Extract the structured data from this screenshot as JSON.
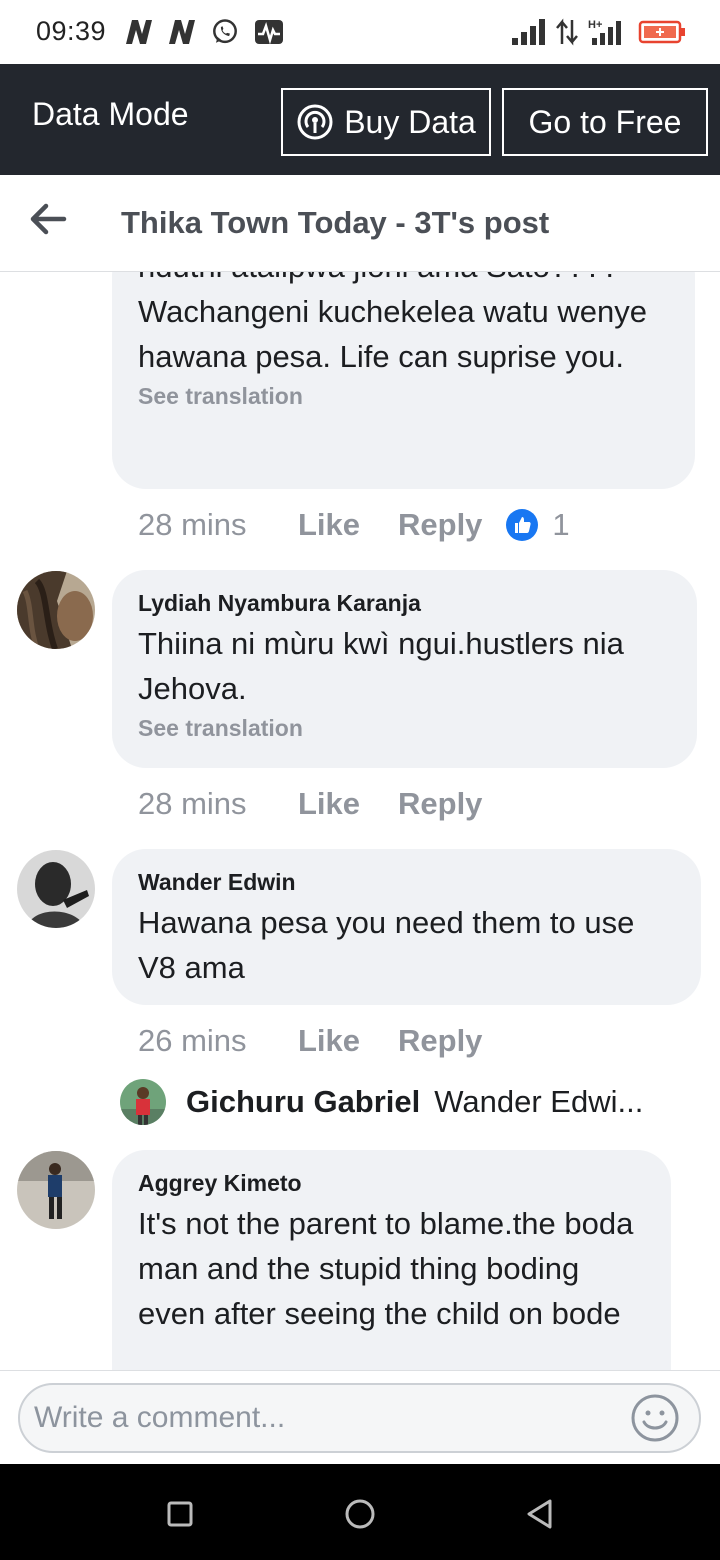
{
  "status_bar": {
    "time": "09:39",
    "icons": [
      "netflix-n-icon",
      "netflix-n-icon",
      "whatsapp-icon",
      "activity-icon",
      "signal-icon",
      "data-arrows-icon",
      "hplus-signal-icon",
      "battery-low-icon"
    ],
    "hplus_label": "H+"
  },
  "data_mode_bar": {
    "label": "Data Mode",
    "buy_data_label": "Buy Data",
    "go_free_label": "Go to Free"
  },
  "header": {
    "title": "Thika Town Today - 3T's post"
  },
  "comments": [
    {
      "lines_partial_top": "ndutni atalipwa jioni ama Sato????",
      "text": "Wachangeni kuchekelea watu wenye hawana pesa. Life can suprise you.",
      "see_translation": "See translation",
      "time": "28 mins",
      "like": "Like",
      "reply": "Reply",
      "reaction_count": "1"
    },
    {
      "author": "Lydiah Nyambura Karanja",
      "text": "Thiina ni mùru kwì ngui.hustlers nia Jehova.",
      "see_translation": "See translation",
      "time": "28 mins",
      "like": "Like",
      "reply": "Reply"
    },
    {
      "author": "Wander Edwin",
      "text": "Hawana pesa you need them to use V8 ama",
      "time": "26 mins",
      "like": "Like",
      "reply": "Reply",
      "reply_preview": {
        "author": "Gichuru Gabriel",
        "snippet": "Wander Edwi..."
      }
    },
    {
      "author": "Aggrey Kimeto",
      "text": "It's not the parent to blame.the boda man and the stupid thing boding even after seeing the child on bode"
    }
  ],
  "composer": {
    "placeholder": "Write a comment..."
  },
  "colors": {
    "data_bar_bg": "#23272e",
    "bubble_bg": "#f0f2f5",
    "meta_text": "#90949c",
    "like_blue": "#1877f2"
  }
}
